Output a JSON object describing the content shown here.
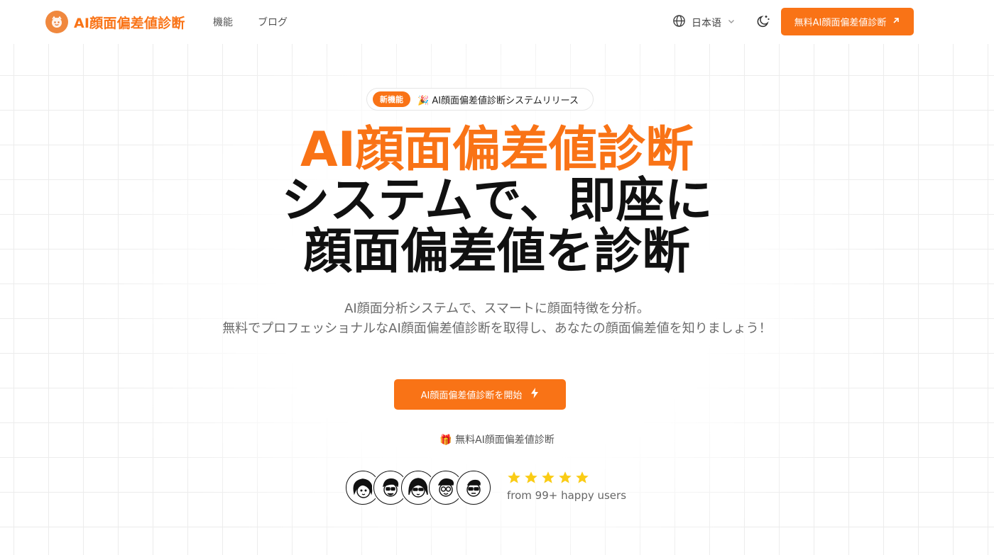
{
  "brand": {
    "name": "AI顔面偏差値診断",
    "accent_color": "#f97316"
  },
  "nav": {
    "items": [
      {
        "label": "機能"
      },
      {
        "label": "ブログ"
      }
    ],
    "language": "日本语",
    "cta_label": "無料AI顔面偏差値診断"
  },
  "hero": {
    "badge_tag": "新機能",
    "badge_text": "🎉 AI顔面偏差値診断システムリリース",
    "title_accent": "AI顔面偏差値診断",
    "title_line2": "システムで、即座に",
    "title_line3": "顔面偏差値を診断",
    "subtitle_line1": "AI顔面分析システムで、スマートに顔面特徴を分析。",
    "subtitle_line2": "無料でプロフェッショナルなAI顔面偏差値診断を取得し、あなたの顔面偏差値を知りましょう！",
    "cta_label": "AI顔面偏差値診断を開始",
    "free_note": "🎁 無料AI顔面偏差値診断"
  },
  "social_proof": {
    "avatars": [
      "avatar-1",
      "avatar-2",
      "avatar-3",
      "avatar-4",
      "avatar-5"
    ],
    "rating": 5,
    "rating_max": 5,
    "text": "from 99+ happy users",
    "star_color": "#facc15"
  }
}
